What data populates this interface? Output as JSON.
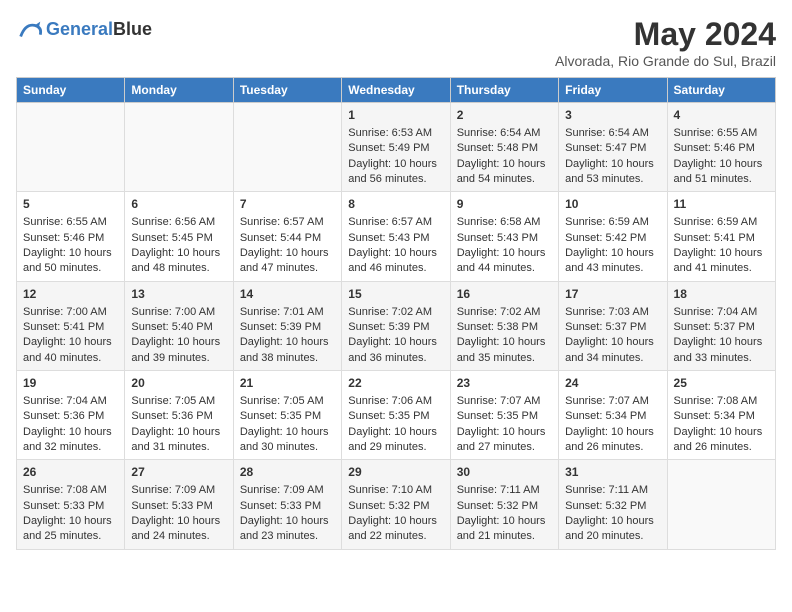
{
  "header": {
    "logo_line1": "General",
    "logo_line2": "Blue",
    "month_title": "May 2024",
    "location": "Alvorada, Rio Grande do Sul, Brazil"
  },
  "days_of_week": [
    "Sunday",
    "Monday",
    "Tuesday",
    "Wednesday",
    "Thursday",
    "Friday",
    "Saturday"
  ],
  "weeks": [
    [
      {
        "day": "",
        "info": ""
      },
      {
        "day": "",
        "info": ""
      },
      {
        "day": "",
        "info": ""
      },
      {
        "day": "1",
        "info": "Sunrise: 6:53 AM\nSunset: 5:49 PM\nDaylight: 10 hours\nand 56 minutes."
      },
      {
        "day": "2",
        "info": "Sunrise: 6:54 AM\nSunset: 5:48 PM\nDaylight: 10 hours\nand 54 minutes."
      },
      {
        "day": "3",
        "info": "Sunrise: 6:54 AM\nSunset: 5:47 PM\nDaylight: 10 hours\nand 53 minutes."
      },
      {
        "day": "4",
        "info": "Sunrise: 6:55 AM\nSunset: 5:46 PM\nDaylight: 10 hours\nand 51 minutes."
      }
    ],
    [
      {
        "day": "5",
        "info": "Sunrise: 6:55 AM\nSunset: 5:46 PM\nDaylight: 10 hours\nand 50 minutes."
      },
      {
        "day": "6",
        "info": "Sunrise: 6:56 AM\nSunset: 5:45 PM\nDaylight: 10 hours\nand 48 minutes."
      },
      {
        "day": "7",
        "info": "Sunrise: 6:57 AM\nSunset: 5:44 PM\nDaylight: 10 hours\nand 47 minutes."
      },
      {
        "day": "8",
        "info": "Sunrise: 6:57 AM\nSunset: 5:43 PM\nDaylight: 10 hours\nand 46 minutes."
      },
      {
        "day": "9",
        "info": "Sunrise: 6:58 AM\nSunset: 5:43 PM\nDaylight: 10 hours\nand 44 minutes."
      },
      {
        "day": "10",
        "info": "Sunrise: 6:59 AM\nSunset: 5:42 PM\nDaylight: 10 hours\nand 43 minutes."
      },
      {
        "day": "11",
        "info": "Sunrise: 6:59 AM\nSunset: 5:41 PM\nDaylight: 10 hours\nand 41 minutes."
      }
    ],
    [
      {
        "day": "12",
        "info": "Sunrise: 7:00 AM\nSunset: 5:41 PM\nDaylight: 10 hours\nand 40 minutes."
      },
      {
        "day": "13",
        "info": "Sunrise: 7:00 AM\nSunset: 5:40 PM\nDaylight: 10 hours\nand 39 minutes."
      },
      {
        "day": "14",
        "info": "Sunrise: 7:01 AM\nSunset: 5:39 PM\nDaylight: 10 hours\nand 38 minutes."
      },
      {
        "day": "15",
        "info": "Sunrise: 7:02 AM\nSunset: 5:39 PM\nDaylight: 10 hours\nand 36 minutes."
      },
      {
        "day": "16",
        "info": "Sunrise: 7:02 AM\nSunset: 5:38 PM\nDaylight: 10 hours\nand 35 minutes."
      },
      {
        "day": "17",
        "info": "Sunrise: 7:03 AM\nSunset: 5:37 PM\nDaylight: 10 hours\nand 34 minutes."
      },
      {
        "day": "18",
        "info": "Sunrise: 7:04 AM\nSunset: 5:37 PM\nDaylight: 10 hours\nand 33 minutes."
      }
    ],
    [
      {
        "day": "19",
        "info": "Sunrise: 7:04 AM\nSunset: 5:36 PM\nDaylight: 10 hours\nand 32 minutes."
      },
      {
        "day": "20",
        "info": "Sunrise: 7:05 AM\nSunset: 5:36 PM\nDaylight: 10 hours\nand 31 minutes."
      },
      {
        "day": "21",
        "info": "Sunrise: 7:05 AM\nSunset: 5:35 PM\nDaylight: 10 hours\nand 30 minutes."
      },
      {
        "day": "22",
        "info": "Sunrise: 7:06 AM\nSunset: 5:35 PM\nDaylight: 10 hours\nand 29 minutes."
      },
      {
        "day": "23",
        "info": "Sunrise: 7:07 AM\nSunset: 5:35 PM\nDaylight: 10 hours\nand 27 minutes."
      },
      {
        "day": "24",
        "info": "Sunrise: 7:07 AM\nSunset: 5:34 PM\nDaylight: 10 hours\nand 26 minutes."
      },
      {
        "day": "25",
        "info": "Sunrise: 7:08 AM\nSunset: 5:34 PM\nDaylight: 10 hours\nand 26 minutes."
      }
    ],
    [
      {
        "day": "26",
        "info": "Sunrise: 7:08 AM\nSunset: 5:33 PM\nDaylight: 10 hours\nand 25 minutes."
      },
      {
        "day": "27",
        "info": "Sunrise: 7:09 AM\nSunset: 5:33 PM\nDaylight: 10 hours\nand 24 minutes."
      },
      {
        "day": "28",
        "info": "Sunrise: 7:09 AM\nSunset: 5:33 PM\nDaylight: 10 hours\nand 23 minutes."
      },
      {
        "day": "29",
        "info": "Sunrise: 7:10 AM\nSunset: 5:32 PM\nDaylight: 10 hours\nand 22 minutes."
      },
      {
        "day": "30",
        "info": "Sunrise: 7:11 AM\nSunset: 5:32 PM\nDaylight: 10 hours\nand 21 minutes."
      },
      {
        "day": "31",
        "info": "Sunrise: 7:11 AM\nSunset: 5:32 PM\nDaylight: 10 hours\nand 20 minutes."
      },
      {
        "day": "",
        "info": ""
      }
    ]
  ],
  "colors": {
    "header_bg": "#3a7abf",
    "header_text": "#ffffff",
    "odd_row_bg": "#f5f5f5",
    "even_row_bg": "#ffffff"
  }
}
